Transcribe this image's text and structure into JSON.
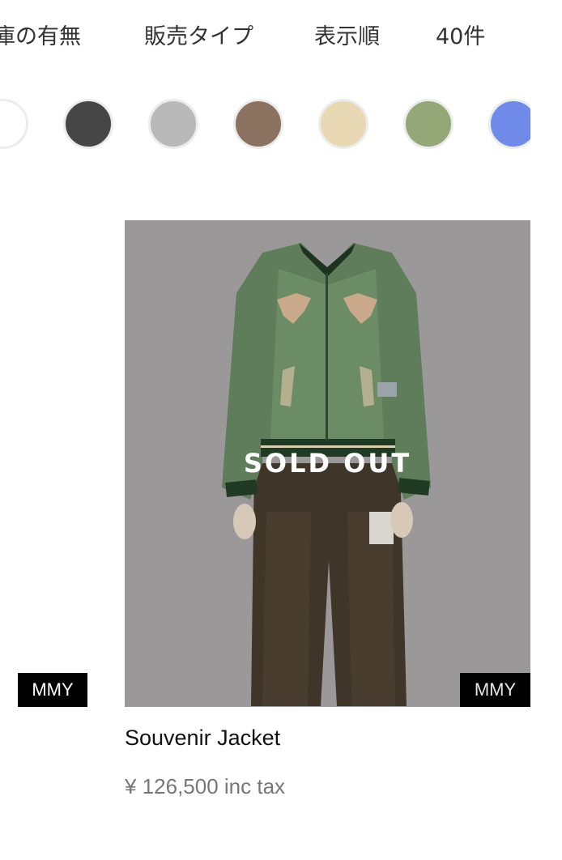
{
  "filters": {
    "stock": "庫の有無",
    "sales_type": "販売タイプ",
    "sort_order": "表示順",
    "count": "40件"
  },
  "color_swatches": [
    {
      "name": "white",
      "color": "#ffffff"
    },
    {
      "name": "charcoal",
      "color": "#464646"
    },
    {
      "name": "gray",
      "color": "#b9b9b9"
    },
    {
      "name": "brown",
      "color": "#8b7260"
    },
    {
      "name": "beige",
      "color": "#e8d8b4"
    },
    {
      "name": "green",
      "color": "#93a876"
    },
    {
      "name": "blue",
      "color": "#6f8ae8"
    }
  ],
  "left_card": {
    "brand": "MMY"
  },
  "product": {
    "status": "SOLD OUT",
    "brand": "MMY",
    "name": "Souvenir Jacket",
    "price": "¥ 126,500 inc tax"
  }
}
